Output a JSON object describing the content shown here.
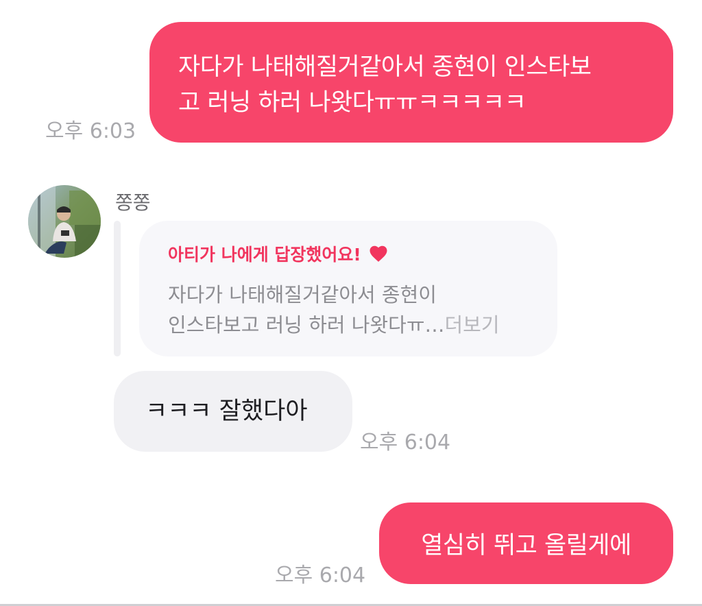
{
  "messages": [
    {
      "id": "msg1",
      "direction": "outgoing",
      "lines": [
        "자다가 나태해질거같아서 종현이 인스타보",
        "고 러닝 하러 나왓다ㅠㅠㅋㅋㅋㅋㅋ"
      ],
      "time": "오후 6:03"
    },
    {
      "id": "msg2",
      "direction": "incoming",
      "sender": "쫑쫑",
      "reply": {
        "title": "아티가 나에게 답장했어요!",
        "icon": "heart-icon",
        "lines": [
          "자다가 나태해질거같아서 종현이",
          "인스타보고 러닝 하러 나왓다ㅠ…"
        ],
        "more": "더보기"
      },
      "text": "ㅋㅋㅋ 잘했다아",
      "time": "오후 6:04"
    },
    {
      "id": "msg3",
      "direction": "outgoing",
      "lines": [
        "열심히 뛰고 올릴게에"
      ],
      "time": "오후 6:04"
    }
  ],
  "colors": {
    "outgoing_bubble": "#f7456a",
    "incoming_bubble": "#f1f1f4",
    "reply_accent": "#f1355e",
    "timestamp": "#a9a9ad"
  }
}
